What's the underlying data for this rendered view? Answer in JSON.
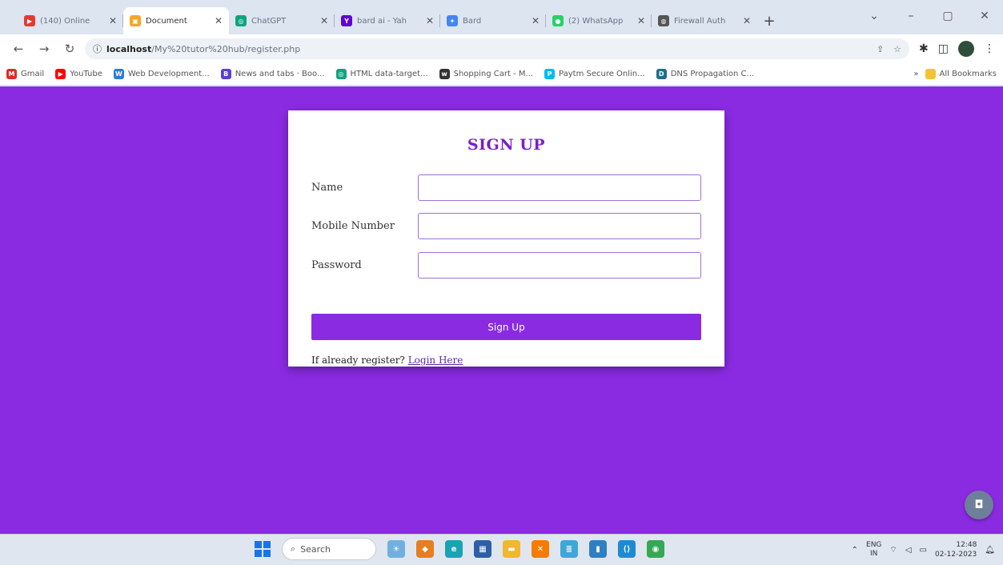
{
  "browser": {
    "tabs": [
      {
        "label": "(140) Online",
        "color": "#e53935",
        "active": false
      },
      {
        "label": "Document",
        "color": "#f4a623",
        "active": true
      },
      {
        "label": "ChatGPT",
        "color": "#10a37f",
        "active": false
      },
      {
        "label": "bard ai - Yah",
        "color": "#6001d2",
        "active": false
      },
      {
        "label": "Bard",
        "color": "#4285f4",
        "active": false
      },
      {
        "label": "(2) WhatsApp",
        "color": "#25d366",
        "active": false
      },
      {
        "label": "Firewall Auth",
        "color": "#555555",
        "active": false
      }
    ],
    "new_tab": "+",
    "url_host": "localhost",
    "url_path": "/My%20tutor%20hub/register.php",
    "bookmarks": [
      {
        "label": "Gmail",
        "color": "#d93025"
      },
      {
        "label": "YouTube",
        "color": "#ff0000"
      },
      {
        "label": "Web Development...",
        "color": "#2b7cd3"
      },
      {
        "label": "News and tabs · Boo...",
        "color": "#5b3fd1"
      },
      {
        "label": "HTML data-target...",
        "color": "#10a37f"
      },
      {
        "label": "Shopping Cart - M...",
        "color": "#333333"
      },
      {
        "label": "Paytm Secure Onlin...",
        "color": "#00baf2"
      },
      {
        "label": "DNS Propagation C...",
        "color": "#1f6f8b"
      }
    ],
    "all_bookmarks": "All Bookmarks"
  },
  "page": {
    "background": "#8a2be2",
    "heading": "SIGN UP",
    "fields": [
      {
        "label": "Name",
        "value": ""
      },
      {
        "label": "Mobile Number",
        "value": ""
      },
      {
        "label": "Password",
        "value": ""
      }
    ],
    "submit_label": "Sign Up",
    "already_text": "If already register?",
    "login_link": "Login Here"
  },
  "taskbar": {
    "search_label": "Search",
    "lang_top": "ENG",
    "lang_bottom": "IN",
    "time": "12:48",
    "date": "02-12-2023"
  }
}
